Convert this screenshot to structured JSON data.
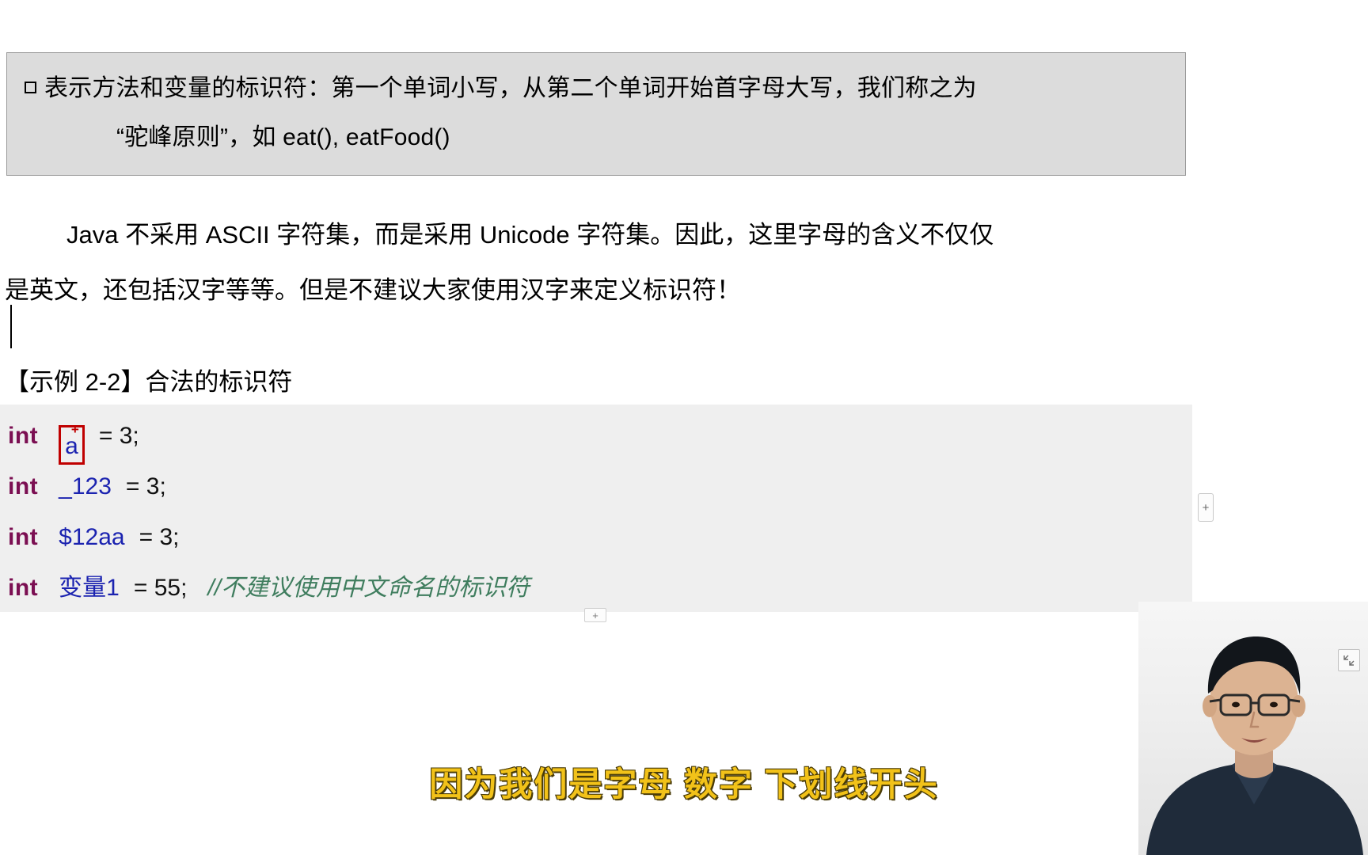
{
  "callout": {
    "bullet_icon": "hollow-square-bullet-icon",
    "line1": "表示方法和变量的标识符：第一个单词小写，从第二个单词开始首字母大写，我们称之为",
    "line2": "“驼峰原则”，如 eat(), eatFood()"
  },
  "body": {
    "line1": "Java 不采用 ASCII 字符集，而是采用 Unicode 字符集。因此，这里字母的含义不仅仅",
    "line2": "是英文，还包括汉字等等。但是不建议大家使用汉字来定义标识符！"
  },
  "example": {
    "heading": "【示例 2-2】合法的标识符"
  },
  "code": {
    "lines": [
      {
        "keyword": "int",
        "identifier": "a",
        "rest": "= 3;",
        "comment": "",
        "selected": true,
        "selection_badge": "+"
      },
      {
        "keyword": "int",
        "identifier": "_123",
        "rest": "= 3;",
        "comment": "",
        "selected": false,
        "selection_badge": ""
      },
      {
        "keyword": "int",
        "identifier": "$12aa",
        "rest": "= 3;",
        "comment": "",
        "selected": false,
        "selection_badge": ""
      },
      {
        "keyword": "int",
        "identifier": "变量1",
        "rest": "= 55;",
        "comment": "//不建议使用中文命名的标识符",
        "selected": false,
        "selection_badge": ""
      }
    ]
  },
  "controls": {
    "add_column_label": "+",
    "add_row_label": "+",
    "video_shrink_icon": "shrink-arrows-icon"
  },
  "subtitle": {
    "text": "因为我们是字母 数字 下划线开头"
  },
  "colors": {
    "callout_background": "#dcdcdc",
    "callout_border": "#9a9a9a",
    "code_background": "#efefef",
    "keyword": "#7b0f52",
    "identifier": "#1b23b0",
    "comment": "#3f7d5e",
    "selection_box": "#c00000",
    "subtitle_fill": "#f2c219",
    "subtitle_outline": "#3a2f07"
  }
}
